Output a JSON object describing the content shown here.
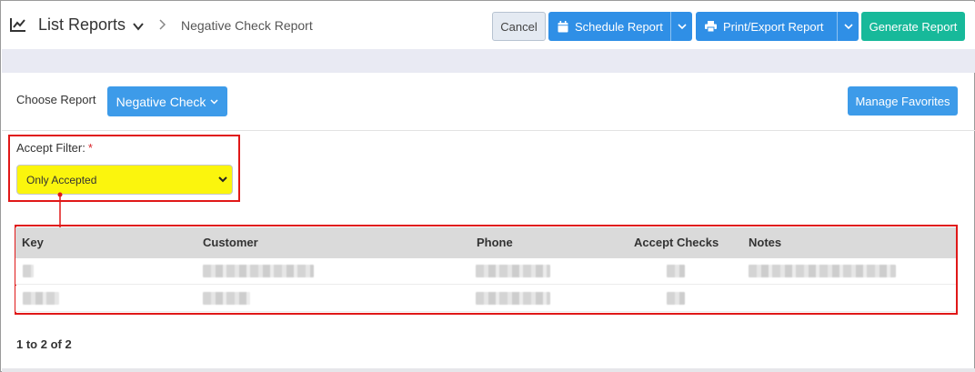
{
  "header": {
    "title": "List Reports",
    "breadcrumb_current": "Negative Check Report",
    "cancel_label": "Cancel",
    "schedule_label": "Schedule Report",
    "print_label": "Print/Export Report",
    "generate_label": "Generate Report"
  },
  "report": {
    "choose_label": "Choose Report",
    "selected_report": "Negative Check",
    "manage_favorites_label": "Manage Favorites"
  },
  "filter": {
    "label": "Accept Filter:",
    "required_mark": "*",
    "value": "Only Accepted"
  },
  "table": {
    "columns": [
      "Key",
      "Customer",
      "Phone",
      "Accept Checks",
      "Notes"
    ],
    "rows": [
      {
        "key": "",
        "customer": "",
        "phone": "",
        "accept_checks": "",
        "notes": ""
      },
      {
        "key": "",
        "customer": "",
        "phone": "",
        "accept_checks": "",
        "notes": ""
      }
    ]
  },
  "pager": "1 to 2 of 2",
  "colors": {
    "primary": "#2f8fe6",
    "success": "#17b99a",
    "highlight": "#fbf50d",
    "annotation_red": "#e01818"
  }
}
